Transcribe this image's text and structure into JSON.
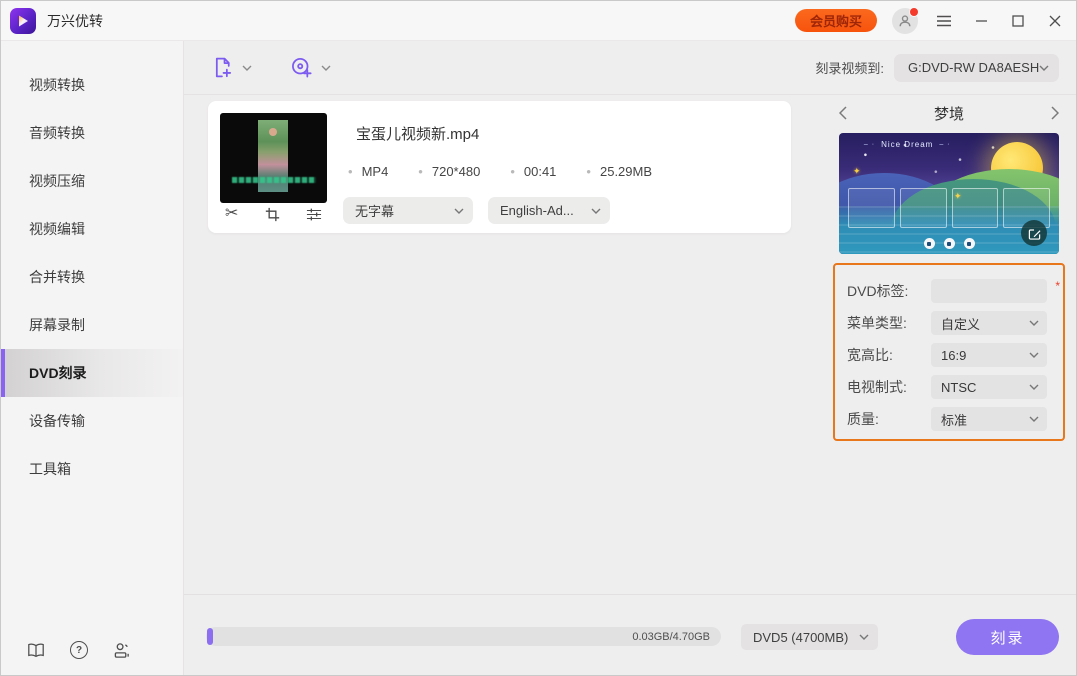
{
  "app": {
    "title": "万兴优转"
  },
  "titlebar": {
    "buy_label": "会员购买"
  },
  "sidebar": {
    "items": [
      {
        "label": "视频转换"
      },
      {
        "label": "音频转换"
      },
      {
        "label": "视频压缩"
      },
      {
        "label": "视频编辑"
      },
      {
        "label": "合并转换"
      },
      {
        "label": "屏幕录制"
      },
      {
        "label": "DVD刻录",
        "active": true
      },
      {
        "label": "设备传输"
      },
      {
        "label": "工具箱"
      }
    ]
  },
  "toolbar": {
    "burn_to_label": "刻录视频到:",
    "burn_to_value": "G:DVD-RW DA8AESH"
  },
  "file_card": {
    "name": "宝蛋儿视频新.mp4",
    "format": "MP4",
    "resolution": "720*480",
    "duration": "00:41",
    "size": "25.29MB",
    "subtitle_value": "无字幕",
    "audio_value": "English-Ad..."
  },
  "template_panel": {
    "name": "梦境",
    "preview_title": "Nice Dream"
  },
  "dvd_settings": {
    "required_mark": "*",
    "rows": [
      {
        "label": "DVD标签:",
        "value": ""
      },
      {
        "label": "菜单类型:",
        "value": "自定义"
      },
      {
        "label": "宽高比:",
        "value": "16:9"
      },
      {
        "label": "电视制式:",
        "value": "NTSC"
      },
      {
        "label": "质量:",
        "value": "标准"
      }
    ]
  },
  "bottom_bar": {
    "progress_text": "0.03GB/4.70GB",
    "disc_value": "DVD5 (4700MB)",
    "burn_label": "刻录"
  },
  "colors": {
    "accent_purple": "#7c5cf0",
    "accent_orange": "#f7530d",
    "settings_border": "#e8771c",
    "progress_fill": "#8b6ff0",
    "required_red": "#e8402a"
  }
}
